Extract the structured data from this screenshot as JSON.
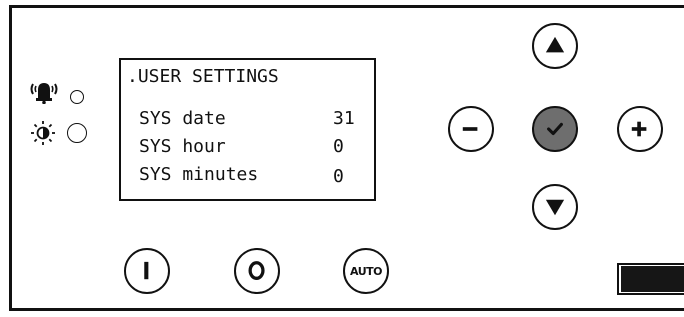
{
  "lcd": {
    "title": ".USER SETTINGS",
    "rows": [
      {
        "label": "SYS date",
        "value": "31"
      },
      {
        "label": "SYS hour",
        "value": "0"
      },
      {
        "label": "SYS minutes",
        "value": "0"
      }
    ]
  },
  "indicators": [
    {
      "icon": "alarm-bell-icon"
    },
    {
      "icon": "contrast-icon"
    }
  ],
  "buttons": {
    "on": {
      "icon": "power-on-icon"
    },
    "off": {
      "icon": "power-off-icon"
    },
    "auto": {
      "label": "AUTO"
    },
    "up": {
      "icon": "arrow-up-icon"
    },
    "down": {
      "icon": "arrow-down-icon"
    },
    "minus": {
      "icon": "minus-icon"
    },
    "plus": {
      "icon": "plus-icon"
    },
    "confirm": {
      "icon": "checkmark-icon"
    }
  },
  "colors": {
    "confirm_fill": "#6e6e6e",
    "ink": "#111111"
  }
}
